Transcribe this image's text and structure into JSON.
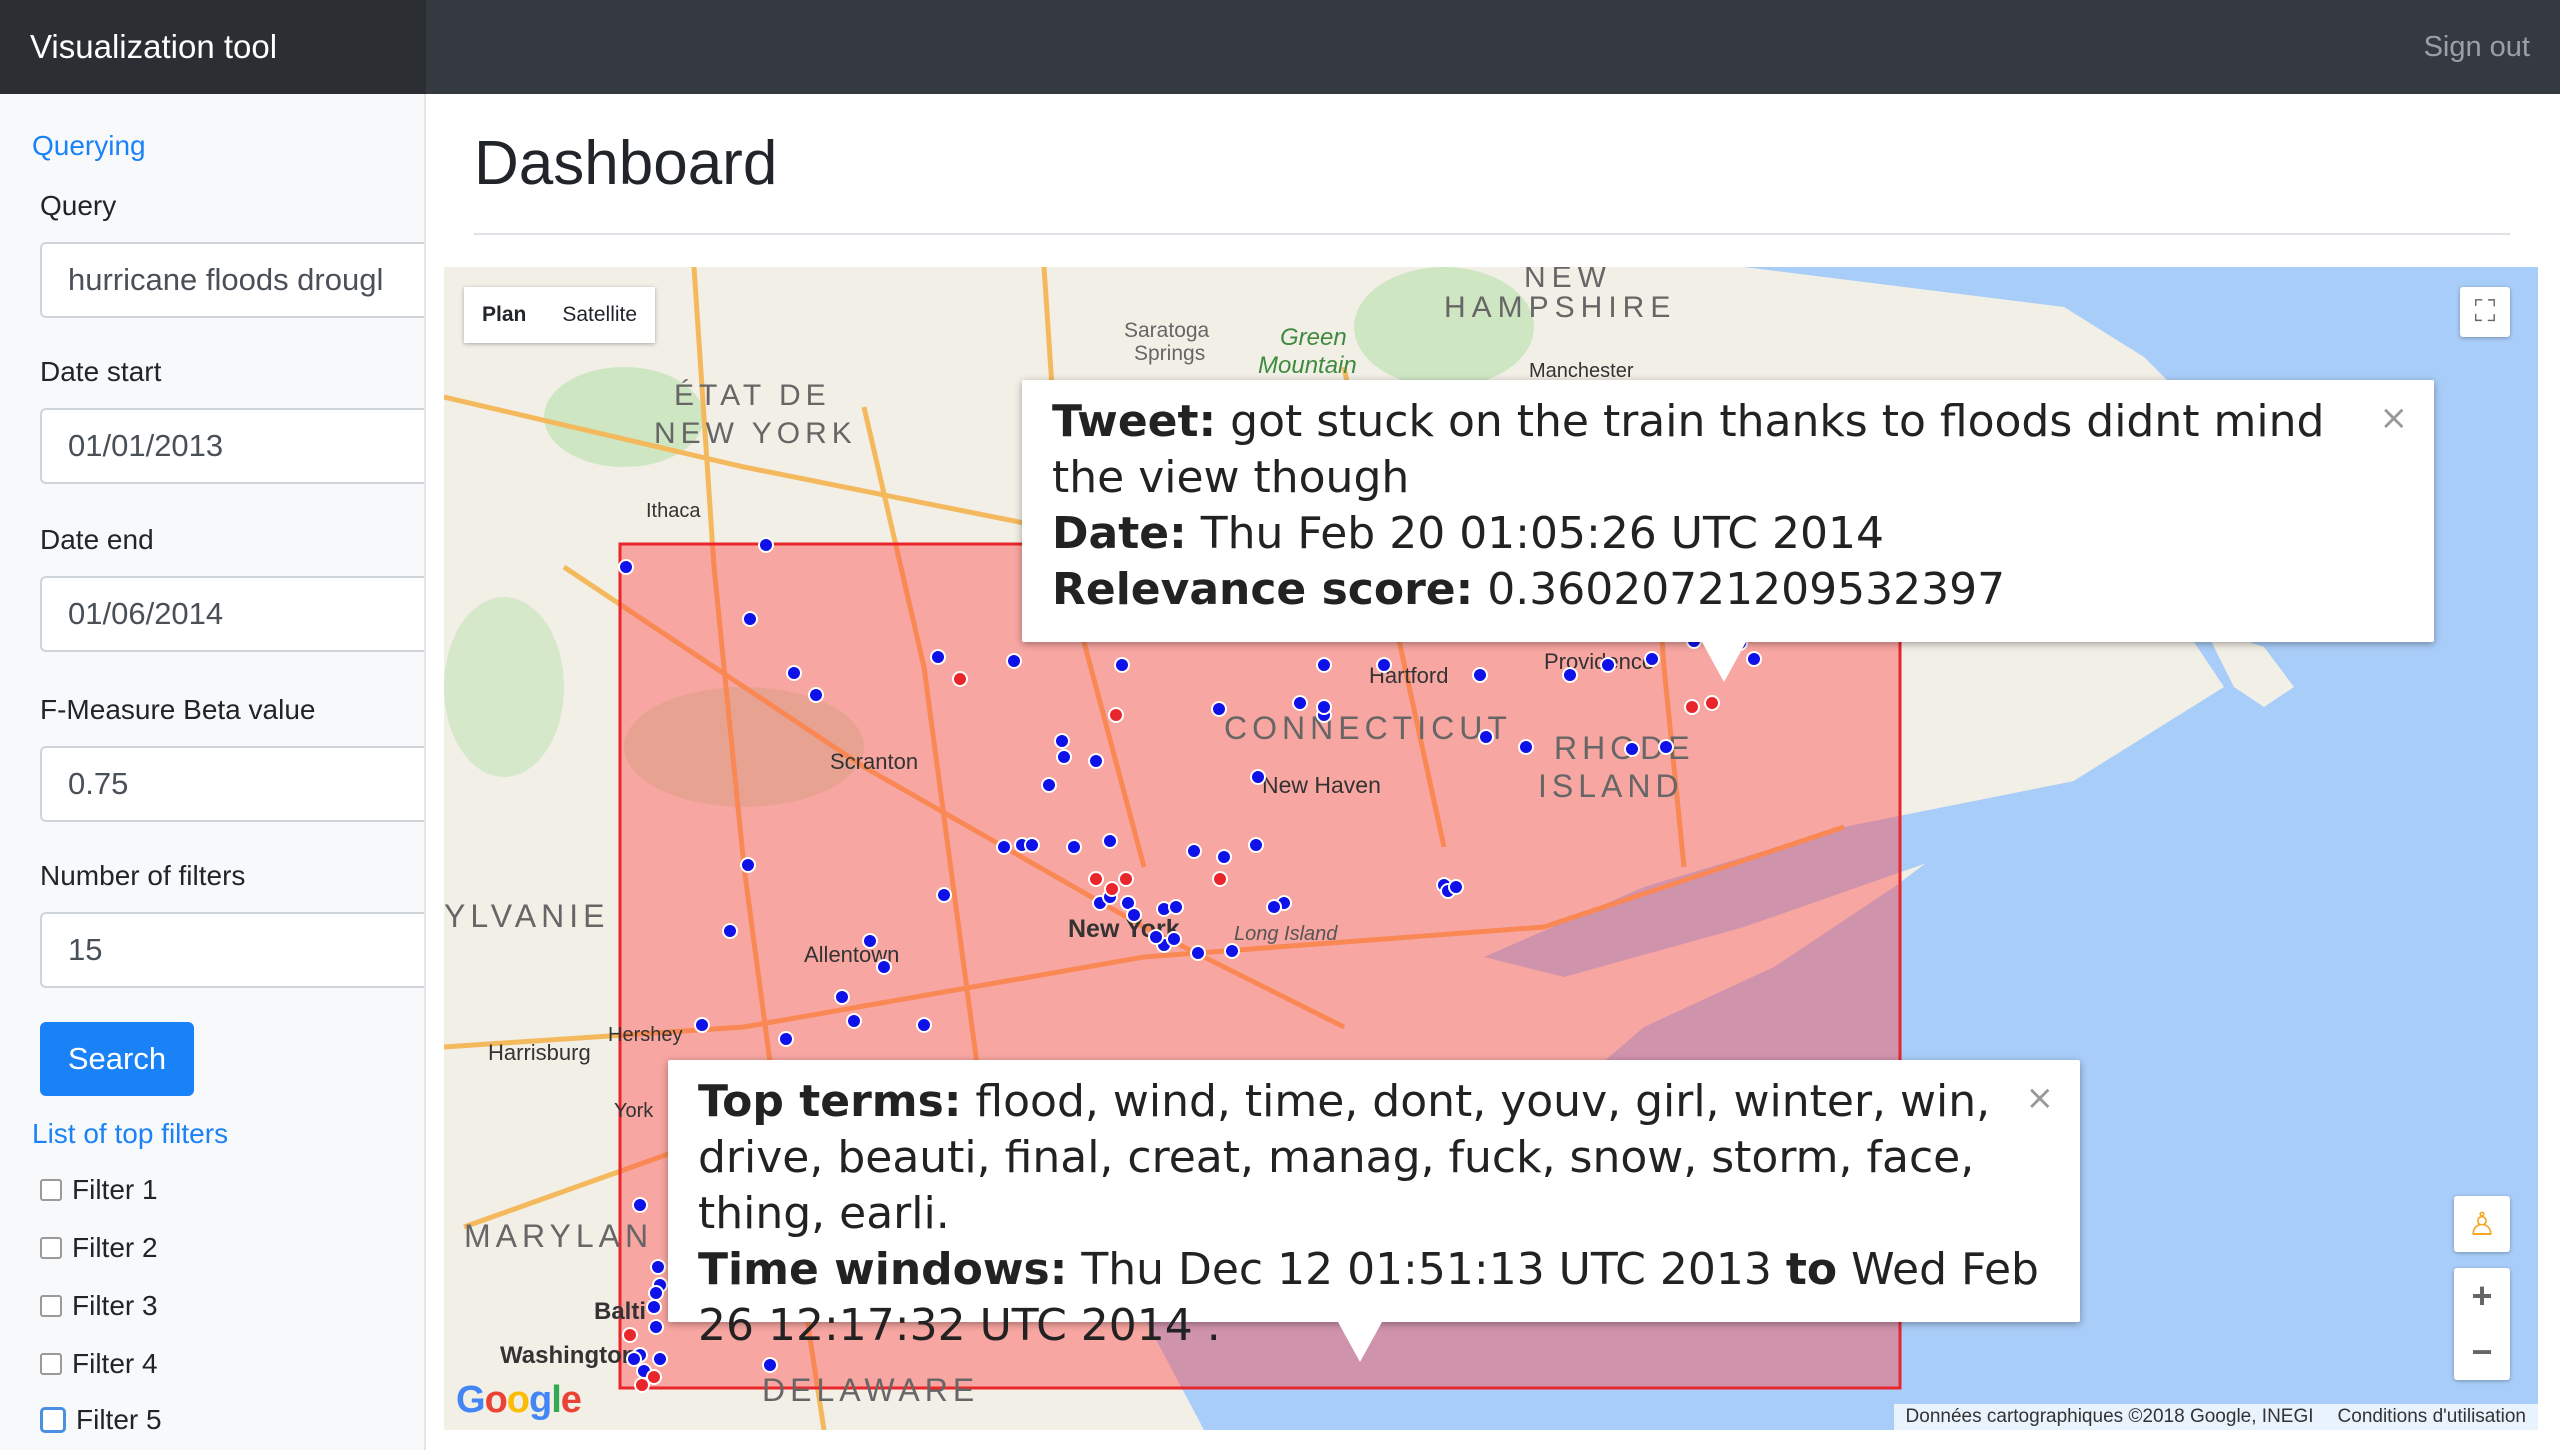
{
  "app": {
    "title": "Visualization tool",
    "signout_label": "Sign out"
  },
  "sidebar": {
    "section_querying": "Querying",
    "query_label": "Query",
    "query_value": "hurricane floods drougl",
    "date_start_label": "Date start",
    "date_start_value": "01/01/2013",
    "date_end_label": "Date end",
    "date_end_value": "01/06/2014",
    "beta_label": "F-Measure Beta value",
    "beta_value": "0.75",
    "filters_label": "Number of filters",
    "filters_value": "15",
    "search_label": "Search",
    "top_filters_heading": "List of top filters",
    "filters": [
      "Filter 1",
      "Filter 2",
      "Filter 3",
      "Filter 4",
      "Filter 5"
    ]
  },
  "main": {
    "page_title": "Dashboard"
  },
  "map": {
    "type_plan": "Plan",
    "type_satellite": "Satellite",
    "attribution": "Données cartographiques ©2018 Google, INEGI",
    "terms": "Conditions d'utilisation",
    "google_logo": "Google",
    "labels": [
      "NEW",
      "HAMPSHIRE",
      "ÉTAT DE",
      "NEW YORK",
      "Saratoga",
      "Springs",
      "Green",
      "Mountain",
      "Manchester",
      "Ithaca",
      "Scranton",
      "Hartford",
      "Providence",
      "CONNECTICUT",
      "RHODE",
      "ISLAND",
      "New Haven",
      "New York",
      "Long Island",
      "Allentown",
      "Harrisburg",
      "Hershey",
      "York",
      "YLVANIE",
      "MARYLAN",
      "Balti",
      "Washington",
      "DELAWARE"
    ],
    "colors": {
      "water": "#a9cdf9",
      "land": "#f2efe6",
      "region_fill": "#ff4d4d",
      "region_stroke": "#e8262b",
      "dot_blue": "#1010e8",
      "dot_red": "#e8262b"
    }
  },
  "infowindow_tweet": {
    "tweet_label": "Tweet:",
    "tweet_text": "got stuck on the train thanks to floods didnt mind the view though",
    "date_label": "Date:",
    "date_value": "Thu Feb 20 01:05:26 UTC 2014",
    "score_label": "Relevance score:",
    "score_value": "0.36020721209532397",
    "close": "×"
  },
  "infowindow_terms": {
    "terms_label": "Top terms:",
    "terms_value": "flood, wind, time, dont, youv, girl, winter, win, drive, beauti, final, creat, manag, fuck, snow, storm, face, thing, earli.",
    "windows_label": "Time windows:",
    "window_start": "Thu Dec 12 01:51:13 UTC 2013",
    "to_label": "to",
    "window_end": "Wed Feb 26 12:17:32 UTC 2014 .",
    "close": "×"
  }
}
